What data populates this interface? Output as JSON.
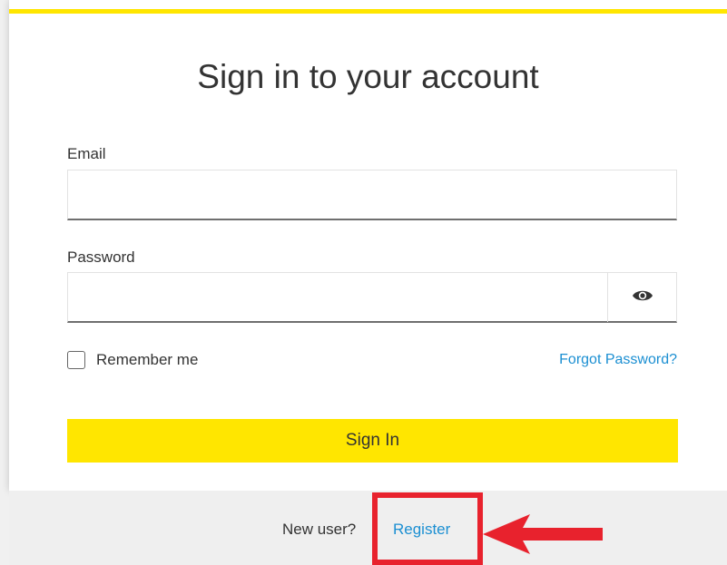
{
  "colors": {
    "accent_yellow": "#ffe600",
    "link_blue": "#1b8fd2",
    "annotation_red": "#e8222d"
  },
  "form": {
    "title": "Sign in to your account",
    "email": {
      "label": "Email",
      "value": "",
      "placeholder": ""
    },
    "password": {
      "label": "Password",
      "value": "",
      "placeholder": "",
      "toggle_icon": "eye-icon"
    },
    "remember_me": {
      "label": "Remember me",
      "checked": false
    },
    "forgot_password": "Forgot Password?",
    "submit_label": "Sign In"
  },
  "footer": {
    "prompt": "New user?",
    "register_link": "Register"
  },
  "annotation": {
    "icons": [
      "highlight-box",
      "arrow-left-icon"
    ]
  }
}
